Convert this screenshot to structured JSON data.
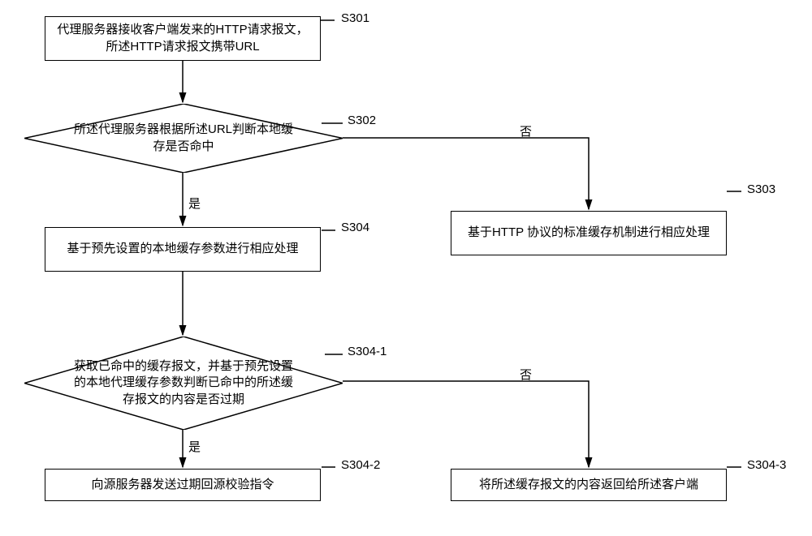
{
  "flow": {
    "s301": {
      "step_id": "S301",
      "text": "代理服务器接收客户端发来的HTTP请求报文，所述HTTP请求报文携带URL"
    },
    "s302": {
      "step_id": "S302",
      "text": "所述代理服务器根据所述URL判断本地缓存是否命中",
      "yes": "是",
      "no": "否"
    },
    "s303": {
      "step_id": "S303",
      "text": "基于HTTP 协议的标准缓存机制进行相应处理"
    },
    "s304": {
      "step_id": "S304",
      "text": "基于预先设置的本地缓存参数进行相应处理"
    },
    "s304_1": {
      "step_id": "S304-1",
      "text": "获取已命中的缓存报文，并基于预先设置的本地代理缓存参数判断已命中的所述缓存报文的内容是否过期",
      "yes": "是",
      "no": "否"
    },
    "s304_2": {
      "step_id": "S304-2",
      "text": "向源服务器发送过期回源校验指令"
    },
    "s304_3": {
      "step_id": "S304-3",
      "text": "将所述缓存报文的内容返回给所述客户端"
    }
  }
}
